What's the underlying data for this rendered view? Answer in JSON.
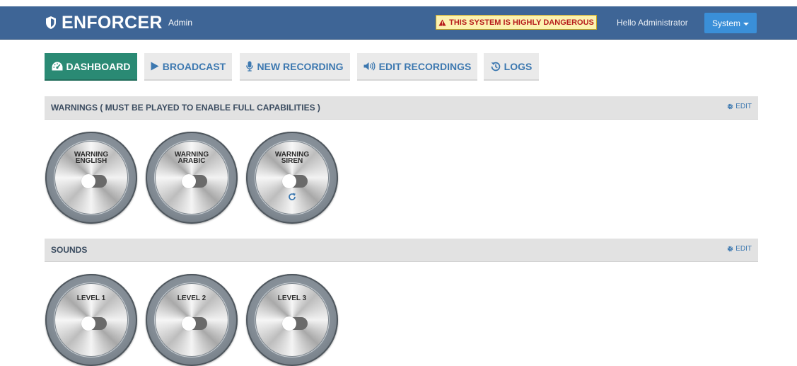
{
  "navbar": {
    "brand": "ENFORCER",
    "admin_link": "Admin",
    "danger_text": "THIS SYSTEM IS HIGHLY DANGEROUS",
    "greeting": "Hello Administrator",
    "system_button": "System"
  },
  "tabs": [
    {
      "label": "DASHBOARD",
      "icon": "dashboard-icon",
      "active": true
    },
    {
      "label": "BROADCAST",
      "icon": "play-icon",
      "active": false
    },
    {
      "label": "NEW RECORDING",
      "icon": "microphone-icon",
      "active": false
    },
    {
      "label": "EDIT RECORDINGS",
      "icon": "speaker-icon",
      "active": false
    },
    {
      "label": "LOGS",
      "icon": "history-icon",
      "active": false
    }
  ],
  "warnings": {
    "title": "WARNINGS ( MUST BE PLAYED TO ENABLE FULL CAPABILITIES )",
    "edit_label": "EDIT",
    "knobs": [
      {
        "line1": "WARNING",
        "line2": "ENGLISH"
      },
      {
        "line1": "WARNING",
        "line2": "ARABIC"
      },
      {
        "line1": "WARNING",
        "line2": "SIREN"
      }
    ]
  },
  "sounds": {
    "title": "SOUNDS",
    "edit_label": "EDIT",
    "knobs": [
      {
        "label": "LEVEL 1"
      },
      {
        "label": "LEVEL 2"
      },
      {
        "label": "LEVEL 3"
      }
    ]
  },
  "colors": {
    "navbar": "#3e6596",
    "active_tab": "#2a8a74",
    "tab_text": "#3c78b0",
    "danger_bg": "#fcf2b0",
    "danger_text": "#b71c1c",
    "system_button": "#3a8fd8"
  }
}
